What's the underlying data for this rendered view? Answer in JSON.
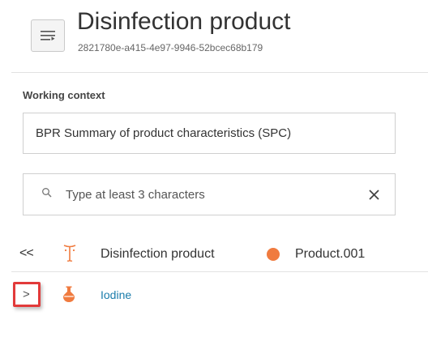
{
  "header": {
    "title": "Disinfection product",
    "subtitle": "2821780e-a415-4e97-9946-52bcec68b179",
    "menu_icon": "menu-icon"
  },
  "working_context": {
    "label": "Working context",
    "value": "BPR Summary of product characteristics (SPC)"
  },
  "search": {
    "placeholder": "Type at least 3 characters",
    "value": "",
    "search_icon": "search-icon",
    "clear_icon": "close-icon"
  },
  "tree": {
    "collapse_label": "<<",
    "root": {
      "icon": "product-icon",
      "name": "Disinfection product",
      "status_color": "#f07b3f",
      "code": "Product.001"
    },
    "children": [
      {
        "expand_label": ">",
        "icon": "substance-flask-icon",
        "name": "Iodine",
        "link_color": "#1a7cab"
      }
    ]
  },
  "colors": {
    "accent_orange": "#f07b3f",
    "link_blue": "#1a7cab",
    "highlight_red": "#e23a3a"
  }
}
